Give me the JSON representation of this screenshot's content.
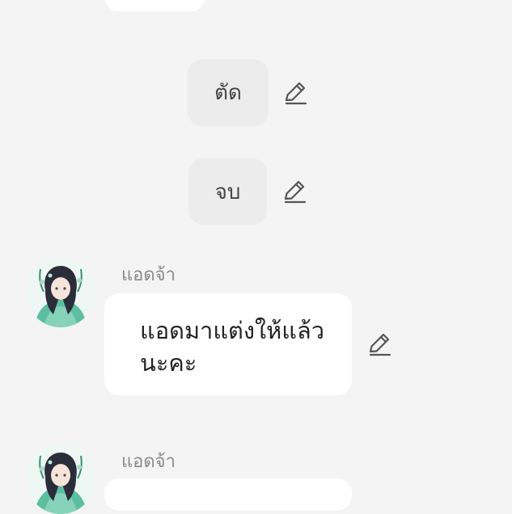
{
  "chat": {
    "narration_cut": "ตัด",
    "narration_end": "จบ",
    "messages": [
      {
        "sender": "แอดจ้า",
        "text": "แอดมาแต่งให้แล้วนะคะ"
      },
      {
        "sender": "แอดจ้า",
        "text": ""
      }
    ]
  },
  "icons": {
    "edit": "pencil-edit-icon",
    "avatar": "anime-girl-avatar"
  },
  "colors": {
    "background": "#f4f4f4",
    "bubble": "#ffffff",
    "narration_bubble": "#ececec",
    "sender_name": "#8a8a8a",
    "icon": "#555555"
  }
}
